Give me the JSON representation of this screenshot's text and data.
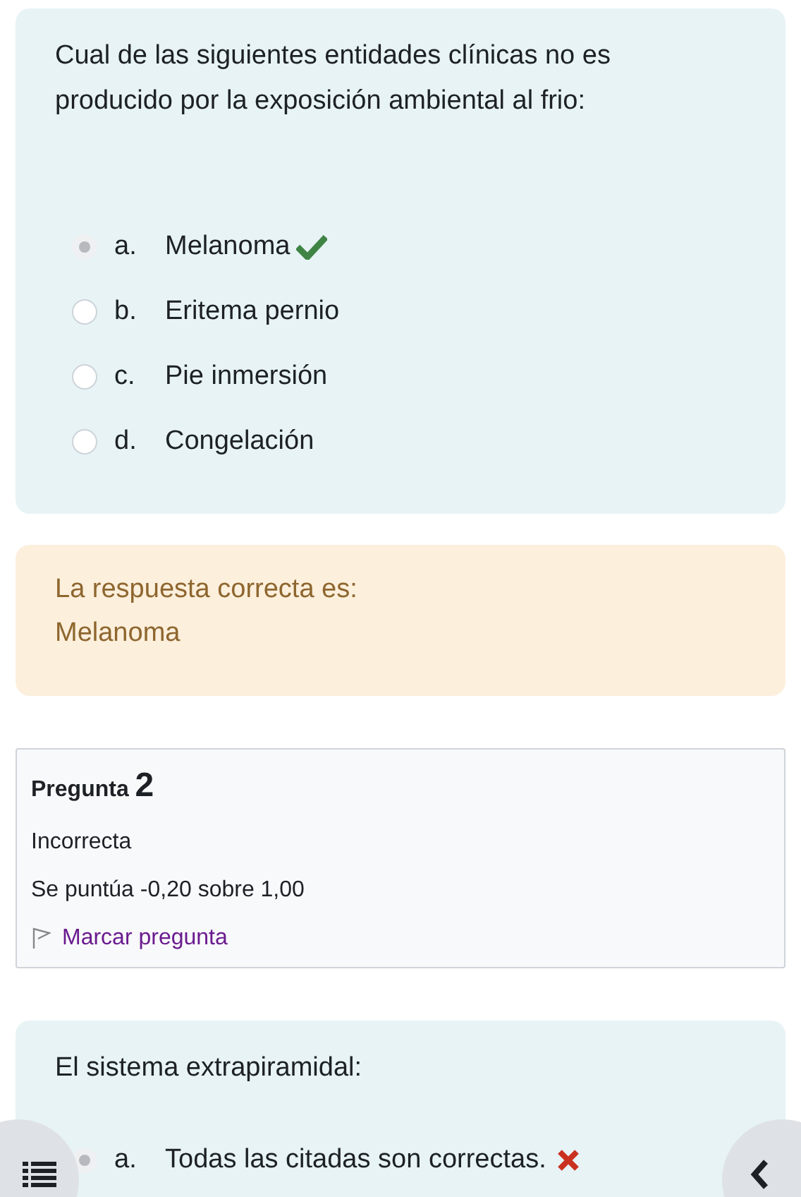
{
  "questions": [
    {
      "text": "Cual de las siguientes entidades clínicas no es producido por la exposición ambiental al frio:",
      "options": [
        {
          "letter": "a.",
          "label": "Melanoma",
          "selected": true,
          "kind": "correct"
        },
        {
          "letter": "b.",
          "label": "Eritema pernio",
          "selected": false,
          "kind": "plain"
        },
        {
          "letter": "c.",
          "label": "Pie inmersión",
          "selected": false,
          "kind": "plain"
        },
        {
          "letter": "d.",
          "label": "Congelación",
          "selected": false,
          "kind": "plain"
        }
      ],
      "feedback": {
        "heading": "La respuesta correcta es:",
        "answer": "Melanoma"
      }
    },
    {
      "info": {
        "label": "Pregunta",
        "number": "2",
        "status": "Incorrecta",
        "score": "Se puntúa -0,20 sobre 1,00",
        "flag": "Marcar pregunta"
      },
      "text": "El sistema extrapiramidal:",
      "options": [
        {
          "letter": "a.",
          "label": "Todas las citadas son correctas.",
          "selected": true,
          "kind": "incorrect"
        }
      ]
    }
  ]
}
